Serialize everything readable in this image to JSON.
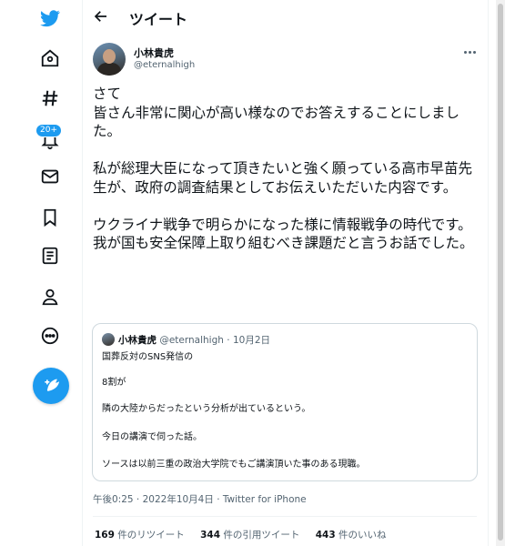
{
  "nav": {
    "icons": [
      "twitter-logo",
      "home-icon",
      "explore-hashtag-icon",
      "notifications-bell-icon",
      "messages-mail-icon",
      "bookmarks-icon",
      "lists-icon",
      "profile-icon",
      "more-circle-icon"
    ],
    "notification_badge": "20+",
    "accent": "#1d9bf0"
  },
  "header": {
    "title": "ツイート"
  },
  "tweet": {
    "author_name": "小林貴虎",
    "author_handle": "@eternalhigh",
    "text": "さて\n皆さん非常に関心が高い様なのでお答えすることにしました。\n\n私が総理大臣になって頂きたいと強く願っている高市早苗先生が、政府の調査結果としてお伝えいただいた内容です。\n\nウクライナ戦争で明らかになった様に情報戦争の時代です。\n我が国も安全保障上取り組むべき課題だと言うお話でした。",
    "timestamp": "午後0:25 · 2022年10月4日 · Twitter for iPhone"
  },
  "quote": {
    "name": "小林貴虎",
    "handle": "@eternalhigh",
    "date": "10月2日",
    "lines": [
      "国葬反対のSNS発信の",
      "8割が",
      "隣の大陸からだったという分析が出ているという。",
      "今日の講演で伺った話。",
      "ソースは以前三重の政治大学院でもご講演頂いた事のある現職。"
    ]
  },
  "stats": {
    "retweets_count": "169",
    "retweets_label": "件のリツイート",
    "quotes_count": "344",
    "quotes_label": "件の引用ツイート",
    "likes_count": "443",
    "likes_label": "件のいいね"
  }
}
